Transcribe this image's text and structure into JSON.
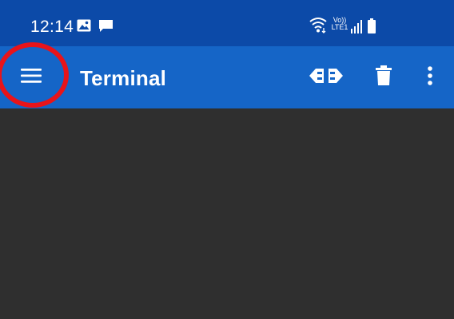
{
  "status_bar": {
    "time": "12:14",
    "notification_icons": [
      "image-icon",
      "message-icon"
    ],
    "network_label_top": "Vo))",
    "network_label_bottom": "LTE1",
    "system_icons": [
      "wifi-icon",
      "signal-icon",
      "battery-icon"
    ]
  },
  "app_bar": {
    "title": "Terminal",
    "menu_icon": "hamburger-menu-icon",
    "actions": [
      "connect-icon",
      "trash-icon",
      "more-vert-icon"
    ]
  },
  "annotation": {
    "highlight_color": "#e8141a",
    "highlighted": "hamburger-menu-button"
  },
  "colors": {
    "status_bar": "#0c4aa8",
    "app_bar": "#1565c7",
    "terminal_bg": "#2f2f2f"
  }
}
